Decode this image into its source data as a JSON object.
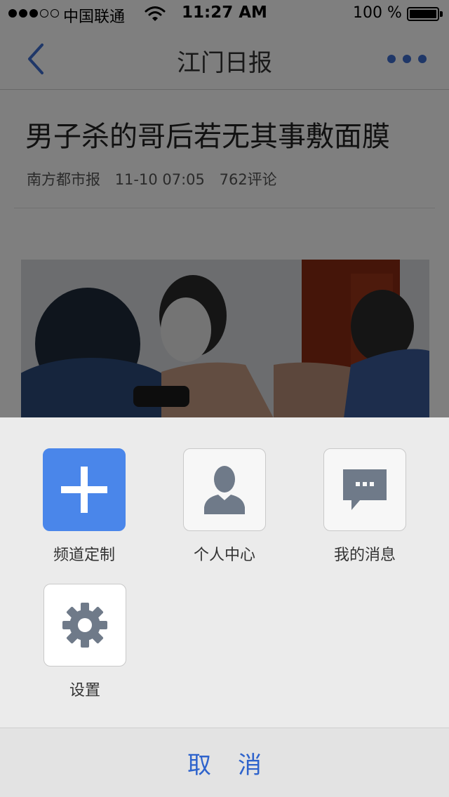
{
  "status_bar": {
    "carrier": "中国联通",
    "time": "11:27 AM",
    "battery": "100 %",
    "signal_bars_filled": 3,
    "signal_bars_total": 5
  },
  "nav": {
    "title": "江门日报",
    "back_icon": "chevron-left-icon",
    "more_icon": "more-dots-icon"
  },
  "article": {
    "title": "男子杀的哥后若无其事敷面膜",
    "source": "南方都市报",
    "datetime": "11-10 07:05",
    "comments": "762评论"
  },
  "menu": {
    "items": [
      {
        "label": "频道定制",
        "icon": "plus-icon"
      },
      {
        "label": "个人中心",
        "icon": "user-icon"
      },
      {
        "label": "我的消息",
        "icon": "message-icon"
      },
      {
        "label": "设置",
        "icon": "gear-icon"
      }
    ],
    "cancel_label": "取消"
  },
  "colors": {
    "accent_blue": "#4a86ea",
    "cancel_text": "#2e63cc",
    "icon_gray": "#6f7a89",
    "sheet_bg": "#ebebeb"
  }
}
